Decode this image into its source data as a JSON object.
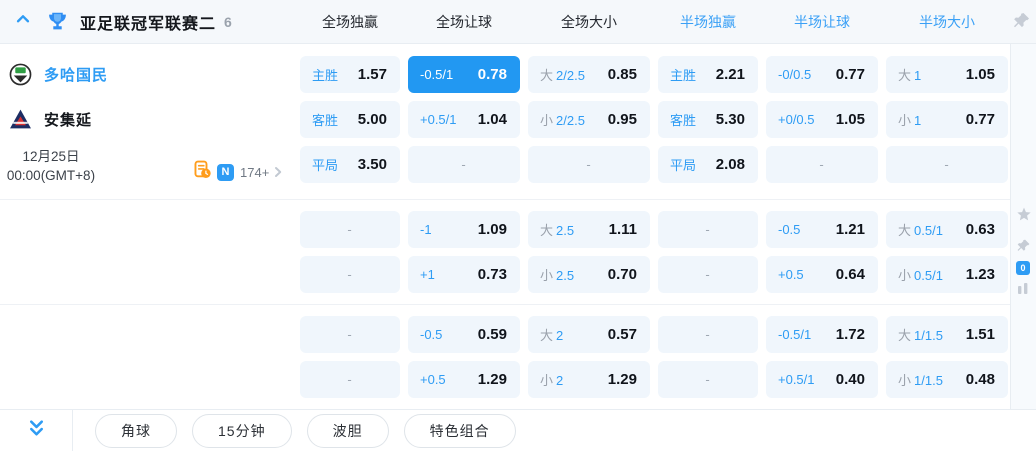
{
  "header": {
    "league_title": "亚足联冠军联赛二",
    "match_count": "6",
    "columns": [
      {
        "label": "全场独赢",
        "accent": false
      },
      {
        "label": "全场让球",
        "accent": false
      },
      {
        "label": "全场大小",
        "accent": false
      },
      {
        "label": "半场独赢",
        "accent": true
      },
      {
        "label": "半场让球",
        "accent": true
      },
      {
        "label": "半场大小",
        "accent": true
      }
    ]
  },
  "match": {
    "home_team": "多哈国民",
    "away_team": "安集延",
    "date": "12月25日",
    "time": "00:00(GMT+8)",
    "extra_markets": "174+",
    "n_badge": "N",
    "zero_badge": "0"
  },
  "odds_groups": [
    {
      "rows": [
        [
          {
            "label": "主胜",
            "value": "1.57"
          },
          {
            "label": "-0.5/1",
            "value": "0.78",
            "hl": true
          },
          {
            "prefix": "大",
            "label": "2/2.5",
            "value": "0.85"
          },
          {
            "label": "主胜",
            "value": "2.21"
          },
          {
            "label": "-0/0.5",
            "value": "0.77"
          },
          {
            "prefix": "大",
            "label": "1",
            "value": "1.05"
          }
        ],
        [
          {
            "label": "客胜",
            "value": "5.00"
          },
          {
            "label": "+0.5/1",
            "value": "1.04"
          },
          {
            "prefix": "小",
            "label": "2/2.5",
            "value": "0.95"
          },
          {
            "label": "客胜",
            "value": "5.30"
          },
          {
            "label": "+0/0.5",
            "value": "1.05"
          },
          {
            "prefix": "小",
            "label": "1",
            "value": "0.77"
          }
        ],
        [
          {
            "label": "平局",
            "value": "3.50"
          },
          {
            "dash": true,
            "placeholder": "-"
          },
          {
            "dash": true,
            "placeholder": "-"
          },
          {
            "label": "平局",
            "value": "2.08"
          },
          {
            "dash": true,
            "placeholder": "-"
          },
          {
            "dash": true,
            "placeholder": "-"
          }
        ]
      ]
    },
    {
      "rows": [
        [
          {
            "dash": true,
            "placeholder": "-"
          },
          {
            "label": "-1",
            "value": "1.09"
          },
          {
            "prefix": "大",
            "label": "2.5",
            "value": "1.11"
          },
          {
            "dash": true,
            "placeholder": "-"
          },
          {
            "label": "-0.5",
            "value": "1.21"
          },
          {
            "prefix": "大",
            "label": "0.5/1",
            "value": "0.63"
          }
        ],
        [
          {
            "dash": true,
            "placeholder": "-"
          },
          {
            "label": "+1",
            "value": "0.73"
          },
          {
            "prefix": "小",
            "label": "2.5",
            "value": "0.70"
          },
          {
            "dash": true,
            "placeholder": "-"
          },
          {
            "label": "+0.5",
            "value": "0.64"
          },
          {
            "prefix": "小",
            "label": "0.5/1",
            "value": "1.23"
          }
        ]
      ]
    },
    {
      "rows": [
        [
          {
            "dash": true,
            "placeholder": "-"
          },
          {
            "label": "-0.5",
            "value": "0.59"
          },
          {
            "prefix": "大",
            "label": "2",
            "value": "0.57"
          },
          {
            "dash": true,
            "placeholder": "-"
          },
          {
            "label": "-0.5/1",
            "value": "1.72"
          },
          {
            "prefix": "大",
            "label": "1/1.5",
            "value": "1.51"
          }
        ],
        [
          {
            "dash": true,
            "placeholder": "-"
          },
          {
            "label": "+0.5",
            "value": "1.29"
          },
          {
            "prefix": "小",
            "label": "2",
            "value": "1.29"
          },
          {
            "dash": true,
            "placeholder": "-"
          },
          {
            "label": "+0.5/1",
            "value": "0.40"
          },
          {
            "prefix": "小",
            "label": "1/1.5",
            "value": "0.48"
          }
        ]
      ]
    }
  ],
  "footer": {
    "buttons": [
      "角球",
      "15分钟",
      "波胆",
      "特色组合"
    ]
  },
  "colors": {
    "accent": "#2e9cf4",
    "highlight_bg": "#2298f2",
    "cell_bg": "#f0f6fc"
  }
}
